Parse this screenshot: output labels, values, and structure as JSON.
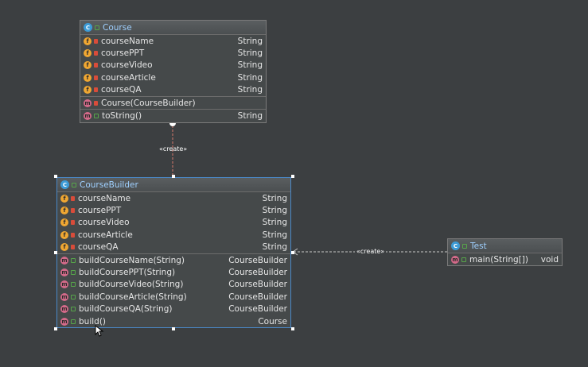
{
  "course": {
    "name": "Course",
    "fields": [
      {
        "name": "courseName",
        "type": "String"
      },
      {
        "name": "coursePPT",
        "type": "String"
      },
      {
        "name": "courseVideo",
        "type": "String"
      },
      {
        "name": "courseArticle",
        "type": "String"
      },
      {
        "name": "courseQA",
        "type": "String"
      }
    ],
    "methods": [
      {
        "name": "Course(CourseBuilder)",
        "type": ""
      },
      {
        "name": "toString()",
        "type": "String"
      }
    ]
  },
  "builder": {
    "name": "CourseBuilder",
    "fields": [
      {
        "name": "courseName",
        "type": "String"
      },
      {
        "name": "coursePPT",
        "type": "String"
      },
      {
        "name": "courseVideo",
        "type": "String"
      },
      {
        "name": "courseArticle",
        "type": "String"
      },
      {
        "name": "courseQA",
        "type": "String"
      }
    ],
    "methods": [
      {
        "name": "buildCourseName(String)",
        "type": "CourseBuilder"
      },
      {
        "name": "buildCoursePPT(String)",
        "type": "CourseBuilder"
      },
      {
        "name": "buildCourseVideo(String)",
        "type": "CourseBuilder"
      },
      {
        "name": "buildCourseArticle(String)",
        "type": "CourseBuilder"
      },
      {
        "name": "buildCourseQA(String)",
        "type": "CourseBuilder"
      },
      {
        "name": "build()",
        "type": "Course"
      }
    ]
  },
  "test": {
    "name": "Test",
    "methods": [
      {
        "name": "main(String[])",
        "type": "void"
      }
    ]
  },
  "relations": {
    "create_label_1": "«create»",
    "create_label_2": "«create»"
  },
  "icons": {
    "field": "f",
    "method": "m",
    "class": "C"
  }
}
